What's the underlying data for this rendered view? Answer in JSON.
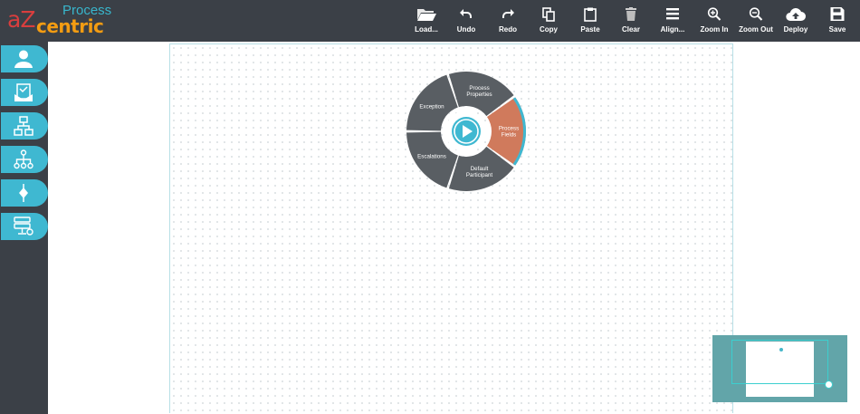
{
  "app": {
    "logo_az": "aZ",
    "logo_process": "Process",
    "logo_centric": "centric"
  },
  "toolbar": [
    {
      "label": "Load...",
      "icon": "folder-open-icon"
    },
    {
      "label": "Undo",
      "icon": "undo-icon"
    },
    {
      "label": "Redo",
      "icon": "redo-icon"
    },
    {
      "label": "Copy",
      "icon": "copy-icon"
    },
    {
      "label": "Paste",
      "icon": "paste-icon"
    },
    {
      "label": "Clear",
      "icon": "trash-icon"
    },
    {
      "label": "Align...",
      "icon": "align-icon"
    },
    {
      "label": "Zoom In",
      "icon": "zoom-in-icon"
    },
    {
      "label": "Zoom Out",
      "icon": "zoom-out-icon"
    },
    {
      "label": "Deploy",
      "icon": "cloud-upload-icon"
    },
    {
      "label": "Save",
      "icon": "save-icon"
    }
  ],
  "sidebar": [
    {
      "icon": "participant-icon"
    },
    {
      "icon": "task-icon"
    },
    {
      "icon": "subprocess-icon"
    },
    {
      "icon": "hierarchy-icon"
    },
    {
      "icon": "gateway-icon"
    },
    {
      "icon": "data-store-icon"
    }
  ],
  "wheel": {
    "segments": [
      {
        "label_lines": [
          "Process",
          "Properties"
        ],
        "active": false
      },
      {
        "label_lines": [
          "Process",
          "Fields"
        ],
        "active": true
      },
      {
        "label_lines": [
          "Default",
          "Participant"
        ],
        "active": false
      },
      {
        "label_lines": [
          "Escalations"
        ],
        "active": false
      },
      {
        "label_lines": [
          "Exception"
        ],
        "active": false
      }
    ],
    "center_icon": "play-icon"
  },
  "colors": {
    "topbar": "#3b4047",
    "sidebar_button": "#3fb8d1",
    "segment": "#595e63",
    "segment_active": "#d07a5c",
    "accent": "#3fb8d1",
    "minimap": "#62a5a9"
  }
}
